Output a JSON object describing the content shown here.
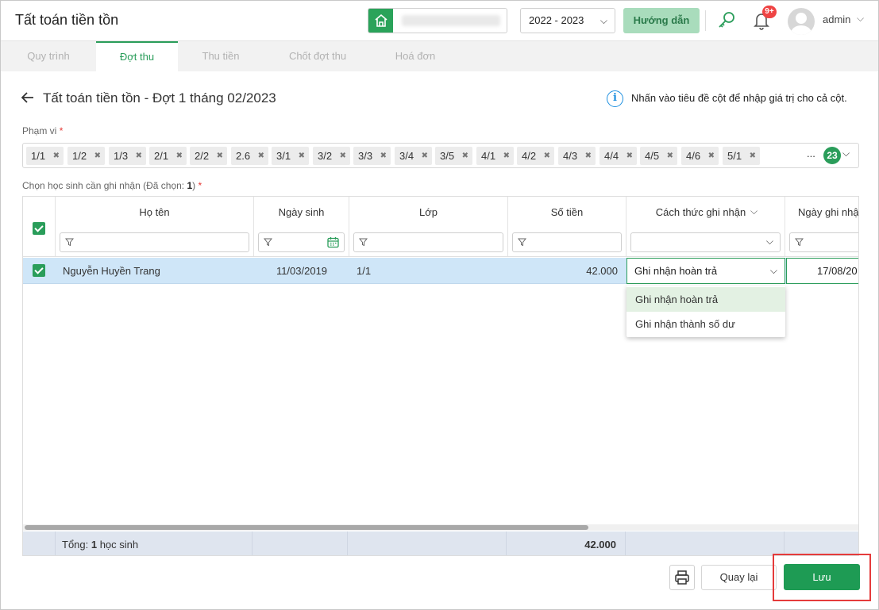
{
  "header": {
    "app_title": "Tất toán tiền tồn",
    "school_icon": "school-home-icon",
    "school_year": "2022 - 2023",
    "guide_label": "Hướng dẫn",
    "notification_badge": "9+",
    "user_name": "admin"
  },
  "tabs": [
    {
      "label": "Quy trình",
      "active": false
    },
    {
      "label": "Đợt thu",
      "active": true
    },
    {
      "label": "Thu tiền",
      "active": false
    },
    {
      "label": "Chốt đợt thu",
      "active": false
    },
    {
      "label": "Hoá đơn",
      "active": false
    }
  ],
  "page": {
    "title": "Tất toán tiền tồn - Đợt 1 tháng 02/2023",
    "info_text": "Nhấn vào tiêu đề cột để nhập giá trị cho cả cột."
  },
  "scope": {
    "label": "Phạm vi",
    "required": "*",
    "chips": [
      "1/1",
      "1/2",
      "1/3",
      "2/1",
      "2/2",
      "2.6",
      "3/1",
      "3/2",
      "3/3",
      "3/4",
      "3/5",
      "4/1",
      "4/2",
      "4/3",
      "4/4",
      "4/5",
      "4/6",
      "5/1"
    ],
    "more": "...",
    "count": "23"
  },
  "selection": {
    "label_prefix": "Chọn học sinh cần ghi nhận (Đã chọn: ",
    "selected_count": "1",
    "label_suffix": ")",
    "required": "*"
  },
  "grid": {
    "columns": {
      "name": "Họ tên",
      "dob": "Ngày sinh",
      "class": "Lớp",
      "amount": "Số tiền",
      "method": "Cách thức ghi nhận",
      "date": "Ngày ghi nhận"
    },
    "rows": [
      {
        "name": "Nguyễn Huyền Trang",
        "dob": "11/03/2019",
        "class": "1/1",
        "amount": "42.000",
        "method": "Ghi nhận hoàn trả",
        "date": "17/08/20"
      }
    ],
    "method_options": [
      "Ghi nhận hoàn trả",
      "Ghi nhận thành số dư"
    ],
    "footer": {
      "total_prefix": "Tổng: ",
      "total_count": "1",
      "total_suffix": " học sinh",
      "total_amount": "42.000"
    }
  },
  "actions": {
    "print_icon": "printer-icon",
    "back_label": "Quay lại",
    "save_label": "Lưu"
  },
  "colors": {
    "brand_green": "#2a9d5a",
    "selected_row": "#cfe6f8",
    "highlight_red": "#e53b3b"
  }
}
